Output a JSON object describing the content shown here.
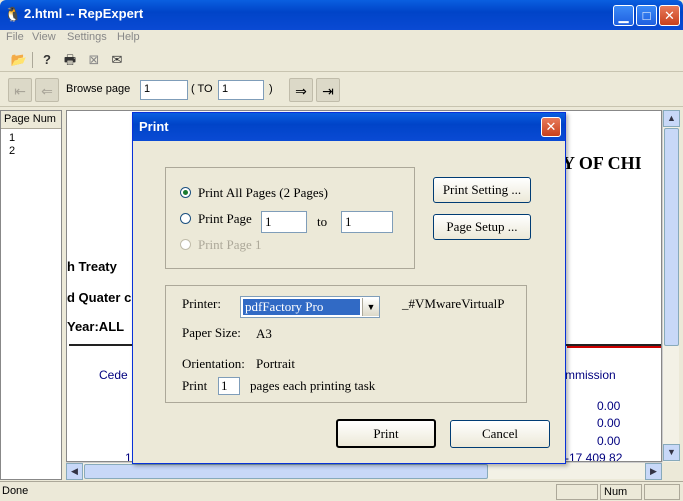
{
  "window": {
    "title": "2.html -- RepExpert",
    "app_icon": "penguin-icon"
  },
  "menu": [
    "File",
    "View",
    "Settings",
    "Help"
  ],
  "toolbar": {
    "icons": [
      "open-folder-icon",
      "help-icon",
      "printer-icon",
      "close-report-icon",
      "mail-icon"
    ]
  },
  "nav": {
    "browse_label": "Browse page",
    "from_value": "1",
    "to_label": "( TO",
    "to_value": "1",
    "close_paren": ")"
  },
  "left_pane": {
    "header": "Page Num",
    "pages": [
      "1",
      "2"
    ]
  },
  "report": {
    "title_fragment": "Y OF CHI",
    "line1": "h Treaty",
    "line2": "d  Quater c",
    "line3": "Year:ALL",
    "col_left": "Cede",
    "col_right": "mmission",
    "values": [
      "0.00",
      "0.00",
      "0.00"
    ],
    "partial_left": "1",
    "partial_right": "-17 409 82"
  },
  "status": {
    "text": "Done",
    "num": "Num"
  },
  "dialog": {
    "title": "Print",
    "option_all": "Print All Pages (2 Pages)",
    "option_page": "Print Page",
    "page_from": "1",
    "to_word": "to",
    "page_to": "1",
    "option_page1": "Print Page 1",
    "print_setting_button": "Print Setting ...",
    "page_setup_button": "Page Setup ...",
    "printer_label": "Printer:",
    "printer_value": "pdfFactory Pro",
    "printer_extra": "_#VMwareVirtualP",
    "paper_label": "Paper Size:",
    "paper_value": "A3",
    "orientation_label": "Orientation:",
    "orientation_value": "Portrait",
    "print_word": "Print",
    "pages_value": "1",
    "pages_suffix": "pages each printing task",
    "print_button": "Print",
    "cancel_button": "Cancel"
  }
}
